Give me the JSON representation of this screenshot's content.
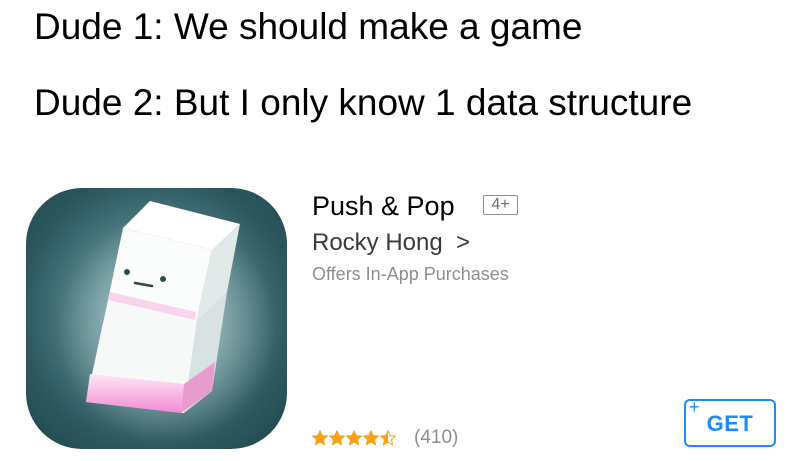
{
  "caption": {
    "line1": "Dude 1: We should make a game",
    "line2": "Dude 2: But I only know 1 data structure"
  },
  "app": {
    "icon": "stacked-blocks-app-icon",
    "name": "Push & Pop",
    "age_rating": "4+",
    "developer": "Rocky Hong",
    "developer_chevron": ">",
    "in_app_purchases": "Offers In-App Purchases",
    "rating": {
      "stars": 4.5,
      "max": 5,
      "count": "(410)"
    },
    "get_button": {
      "plus": "+",
      "label": "GET"
    }
  },
  "colors": {
    "accent": "#1a8cff",
    "star": "#f7a21b",
    "secondary_text": "#8e8e93",
    "icon_background": "#2e5a61",
    "block_glow": "#f4a9dc"
  }
}
